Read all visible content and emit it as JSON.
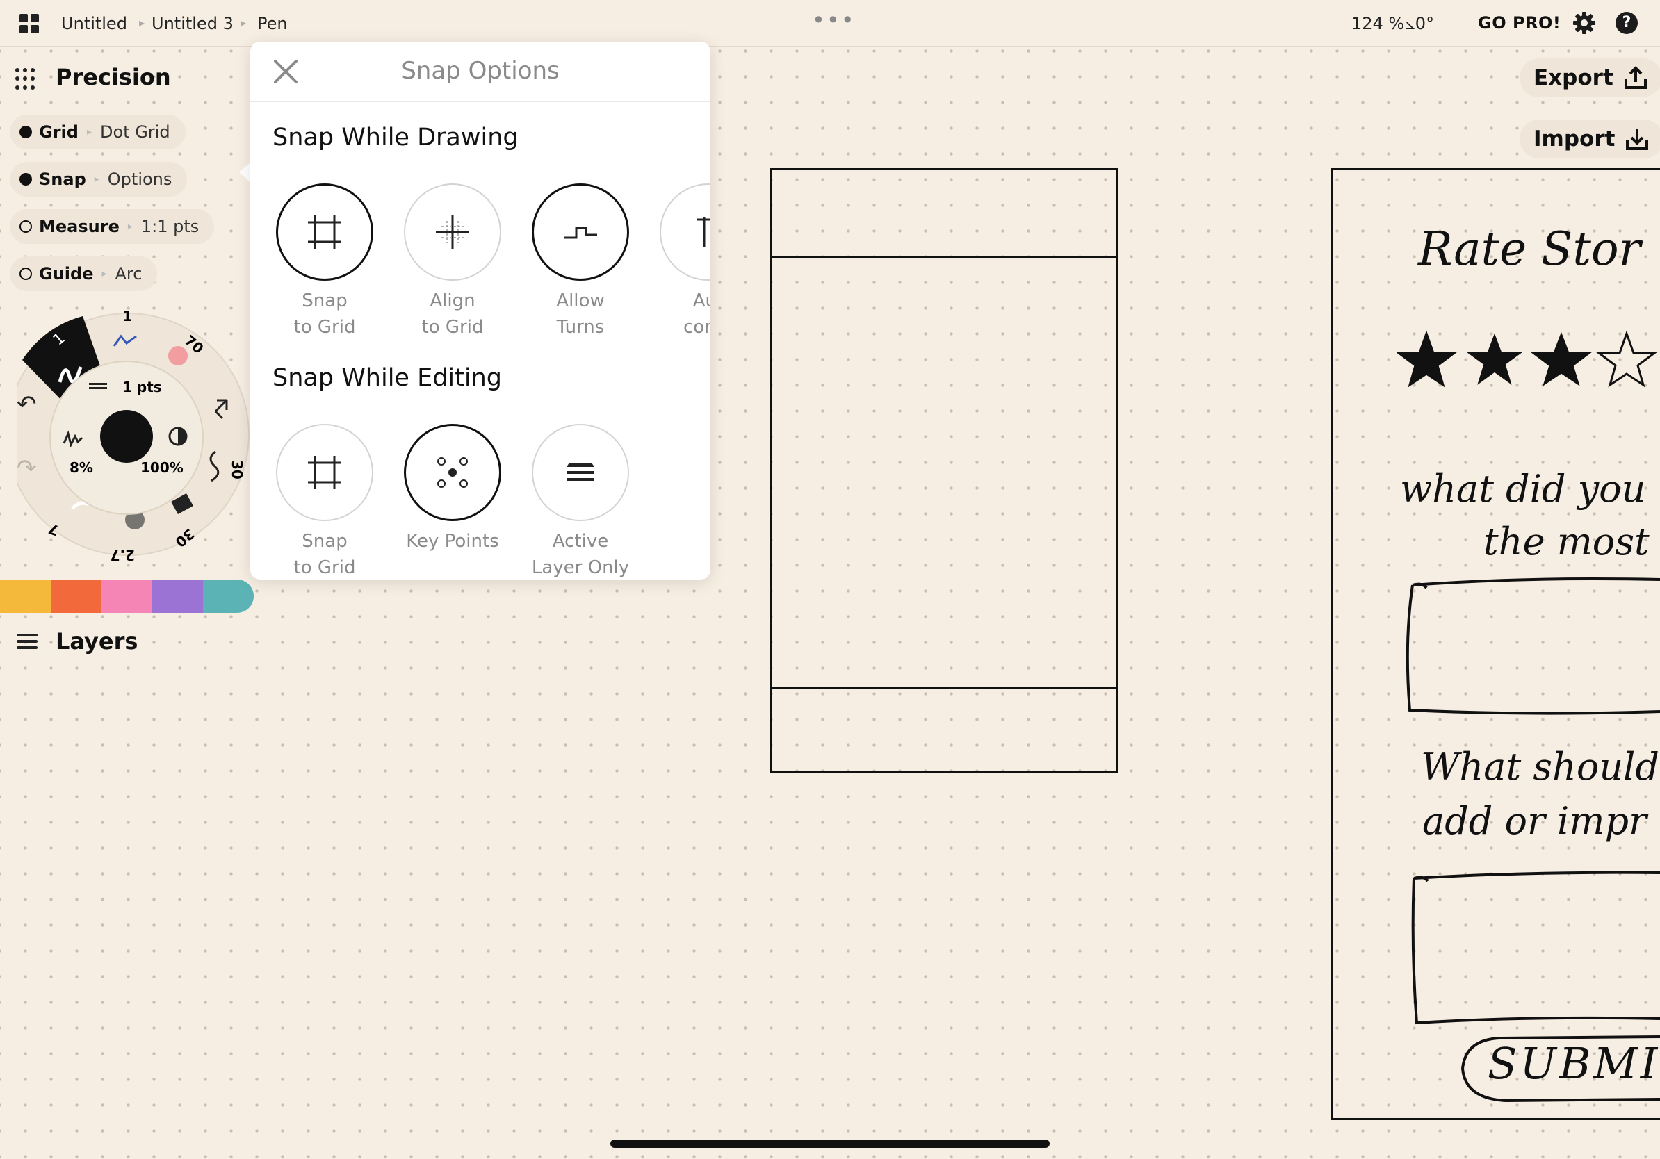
{
  "topbar": {
    "breadcrumbs": [
      "Untitled",
      "Untitled 3",
      "Pen"
    ],
    "zoom": "124 %",
    "angle": "⦣0°",
    "gopro_label": "GO PRO!",
    "help_label": "?"
  },
  "left_panel": {
    "title": "Precision",
    "toggles": [
      {
        "key": "Grid",
        "value": "Dot Grid",
        "on": true
      },
      {
        "key": "Snap",
        "value": "Options",
        "on": true
      },
      {
        "key": "Measure",
        "value": "1:1 pts",
        "on": false
      },
      {
        "key": "Guide",
        "value": "Arc",
        "on": false
      }
    ],
    "wheel": {
      "size_label": "1 pts",
      "opacity_label": "8%",
      "hardness_label": "100%",
      "ring_labels": [
        "1",
        "70",
        "30",
        "30",
        "2.7",
        "7"
      ]
    },
    "colors": [
      "#f4b93a",
      "#f26a3c",
      "#f485b5",
      "#9a73d4",
      "#5bb3b5"
    ],
    "layers_label": "Layers"
  },
  "snap_options": {
    "title": "Snap Options",
    "while_drawing_title": "Snap While Drawing",
    "while_drawing": [
      {
        "label": "Snap\nto Grid",
        "on": true,
        "icon": "snap-grid-icon"
      },
      {
        "label": "Align\nto Grid",
        "on": false,
        "icon": "align-grid-icon"
      },
      {
        "label": "Allow\nTurns",
        "on": true,
        "icon": "turns-icon"
      },
      {
        "label": "Aut\ncomp",
        "on": false,
        "icon": "autocomplete-icon"
      }
    ],
    "while_editing_title": "Snap While Editing",
    "while_editing": [
      {
        "label": "Snap\nto Grid",
        "on": false,
        "icon": "snap-grid-icon"
      },
      {
        "label": "Key Points",
        "on": true,
        "icon": "key-points-icon"
      },
      {
        "label": "Active\nLayer Only",
        "on": false,
        "icon": "layers-stack-icon"
      }
    ]
  },
  "right_buttons": {
    "export_label": "Export",
    "import_label": "Import"
  },
  "canvas": {
    "sketch_texts": [
      "Rate Stor",
      "what did you",
      "the most",
      "What should",
      "add or impr",
      "SUBMI"
    ]
  },
  "colors": {
    "background": "#f6eee2",
    "panel_pill": "#efe6d9",
    "ink": "#111111"
  }
}
